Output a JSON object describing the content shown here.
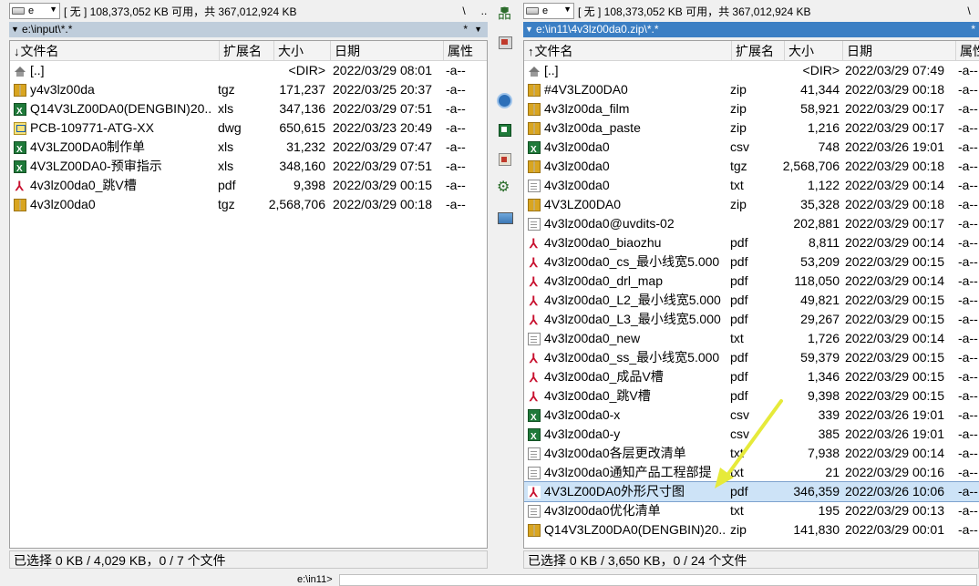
{
  "left": {
    "drive": {
      "letter": "e",
      "info": "[ 无 ]  108,373,052 KB 可用，共 367,012,924 KB"
    },
    "nav": {
      "root": "\\",
      "up": ".."
    },
    "path": "e:\\input\\*.*",
    "path_star": "*",
    "path_dropdown": "▼",
    "columns": {
      "name": "文件名",
      "ext": "扩展名",
      "size": "大小",
      "date": "日期",
      "attr": "属性",
      "sort_indicator": "↓"
    },
    "rows": [
      {
        "icon": "up",
        "name": "[..]",
        "ext": "",
        "size": "<DIR>",
        "date": "2022/03/29 08:01",
        "attr": "-a--"
      },
      {
        "icon": "archive",
        "name": "y4v3lz00da",
        "ext": "tgz",
        "size": "171,237",
        "date": "2022/03/25 20:37",
        "attr": "-a--"
      },
      {
        "icon": "excel",
        "name": "Q14V3LZ00DA0(DENGBIN)20..",
        "ext": "xls",
        "size": "347,136",
        "date": "2022/03/29 07:51",
        "attr": "-a--"
      },
      {
        "icon": "dwg",
        "name": "PCB-109771-ATG-XX",
        "ext": "dwg",
        "size": "650,615",
        "date": "2022/03/23 20:49",
        "attr": "-a--"
      },
      {
        "icon": "excel",
        "name": "4V3LZ00DA0制作单",
        "ext": "xls",
        "size": "31,232",
        "date": "2022/03/29 07:47",
        "attr": "-a--"
      },
      {
        "icon": "excel",
        "name": "4V3LZ00DA0-预审指示",
        "ext": "xls",
        "size": "348,160",
        "date": "2022/03/29 07:51",
        "attr": "-a--"
      },
      {
        "icon": "pdf",
        "name": "4v3lz00da0_跳V槽",
        "ext": "pdf",
        "size": "9,398",
        "date": "2022/03/29 00:15",
        "attr": "-a--"
      },
      {
        "icon": "archive",
        "name": "4v3lz00da0",
        "ext": "tgz",
        "size": "2,568,706",
        "date": "2022/03/29 00:18",
        "attr": "-a--"
      }
    ],
    "status": "已选择 0 KB / 4,029 KB，0 / 7 个文件"
  },
  "right": {
    "drive": {
      "letter": "e",
      "info": "[ 无 ]  108,373,052 KB 可用，共 367,012,924 KB"
    },
    "nav": {
      "root": "\\"
    },
    "path": "e:\\in11\\4v3lz00da0.zip\\*.*",
    "path_star": "*",
    "path_dropdown": "▼",
    "columns": {
      "name": "文件名",
      "ext": "扩展名",
      "size": "大小",
      "date": "日期",
      "attr": "属性",
      "sort_indicator": "↑"
    },
    "rows": [
      {
        "icon": "up",
        "name": "[..]",
        "ext": "",
        "size": "<DIR>",
        "date": "2022/03/29 07:49",
        "attr": "-a--"
      },
      {
        "icon": "archive",
        "name": "#4V3LZ00DA0",
        "ext": "zip",
        "size": "41,344",
        "date": "2022/03/29 00:18",
        "attr": "-a--"
      },
      {
        "icon": "archive",
        "name": "4v3lz00da_film",
        "ext": "zip",
        "size": "58,921",
        "date": "2022/03/29 00:17",
        "attr": "-a--"
      },
      {
        "icon": "archive",
        "name": "4v3lz00da_paste",
        "ext": "zip",
        "size": "1,216",
        "date": "2022/03/29 00:17",
        "attr": "-a--"
      },
      {
        "icon": "excel",
        "name": "4v3lz00da0",
        "ext": "csv",
        "size": "748",
        "date": "2022/03/26 19:01",
        "attr": "-a--"
      },
      {
        "icon": "archive",
        "name": "4v3lz00da0",
        "ext": "tgz",
        "size": "2,568,706",
        "date": "2022/03/29 00:18",
        "attr": "-a--"
      },
      {
        "icon": "file",
        "name": "4v3lz00da0",
        "ext": "txt",
        "size": "1,122",
        "date": "2022/03/29 00:14",
        "attr": "-a--"
      },
      {
        "icon": "archive",
        "name": "4V3LZ00DA0",
        "ext": "zip",
        "size": "35,328",
        "date": "2022/03/29 00:18",
        "attr": "-a--"
      },
      {
        "icon": "file",
        "name": "4v3lz00da0@uvdits-02",
        "ext": "",
        "size": "202,881",
        "date": "2022/03/29 00:17",
        "attr": "-a--"
      },
      {
        "icon": "pdf",
        "name": "4v3lz00da0_biaozhu",
        "ext": "pdf",
        "size": "8,811",
        "date": "2022/03/29 00:14",
        "attr": "-a--"
      },
      {
        "icon": "pdf",
        "name": "4v3lz00da0_cs_最小线宽5.000",
        "ext": "pdf",
        "size": "53,209",
        "date": "2022/03/29 00:15",
        "attr": "-a--"
      },
      {
        "icon": "pdf",
        "name": "4v3lz00da0_drl_map",
        "ext": "pdf",
        "size": "118,050",
        "date": "2022/03/29 00:14",
        "attr": "-a--"
      },
      {
        "icon": "pdf",
        "name": "4v3lz00da0_L2_最小线宽5.000",
        "ext": "pdf",
        "size": "49,821",
        "date": "2022/03/29 00:15",
        "attr": "-a--"
      },
      {
        "icon": "pdf",
        "name": "4v3lz00da0_L3_最小线宽5.000",
        "ext": "pdf",
        "size": "29,267",
        "date": "2022/03/29 00:15",
        "attr": "-a--"
      },
      {
        "icon": "file",
        "name": "4v3lz00da0_new",
        "ext": "txt",
        "size": "1,726",
        "date": "2022/03/29 00:14",
        "attr": "-a--"
      },
      {
        "icon": "pdf",
        "name": "4v3lz00da0_ss_最小线宽5.000",
        "ext": "pdf",
        "size": "59,379",
        "date": "2022/03/29 00:15",
        "attr": "-a--"
      },
      {
        "icon": "pdf",
        "name": "4v3lz00da0_成品V槽",
        "ext": "pdf",
        "size": "1,346",
        "date": "2022/03/29 00:15",
        "attr": "-a--"
      },
      {
        "icon": "pdf",
        "name": "4v3lz00da0_跳V槽",
        "ext": "pdf",
        "size": "9,398",
        "date": "2022/03/29 00:15",
        "attr": "-a--"
      },
      {
        "icon": "excel",
        "name": "4v3lz00da0-x",
        "ext": "csv",
        "size": "339",
        "date": "2022/03/26 19:01",
        "attr": "-a--"
      },
      {
        "icon": "excel",
        "name": "4v3lz00da0-y",
        "ext": "csv",
        "size": "385",
        "date": "2022/03/26 19:01",
        "attr": "-a--"
      },
      {
        "icon": "file",
        "name": "4v3lz00da0各层更改清单",
        "ext": "txt",
        "size": "7,938",
        "date": "2022/03/29 00:14",
        "attr": "-a--"
      },
      {
        "icon": "file",
        "name": "4v3lz00da0通知产品工程部提",
        "ext": "txt",
        "size": "21",
        "date": "2022/03/29 00:16",
        "attr": "-a--"
      },
      {
        "icon": "pdf",
        "name": "4V3LZ00DA0外形尺寸图",
        "ext": "pdf",
        "size": "346,359",
        "date": "2022/03/26 10:06",
        "attr": "-a--"
      },
      {
        "icon": "file",
        "name": "4v3lz00da0优化清单",
        "ext": "txt",
        "size": "195",
        "date": "2022/03/29 00:13",
        "attr": "-a--"
      },
      {
        "icon": "archive",
        "name": "Q14V3LZ00DA0(DENGBIN)20..",
        "ext": "zip",
        "size": "141,830",
        "date": "2022/03/29 00:01",
        "attr": "-a--"
      }
    ],
    "selected_row": 22,
    "status": "已选择 0 KB / 3,650 KB，0 / 24 个文件"
  },
  "toolbar": [
    "network-icon",
    "screenshot-icon",
    "sync-icon",
    "excel-tool-icon",
    "image-tool-icon",
    "settings-icon",
    "picture-icon"
  ],
  "cmdline": {
    "prefix": "e:\\in11>",
    "value": ""
  },
  "annotation": {
    "arrow_color": "#e6ea3a"
  }
}
